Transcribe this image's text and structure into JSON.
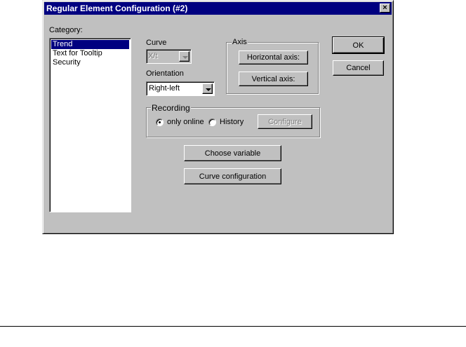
{
  "dialog": {
    "title": "Regular Element Configuration (#2)",
    "close": "×"
  },
  "category": {
    "label": "Category:",
    "items": [
      "Trend",
      "Text for Tooltip",
      "Security"
    ],
    "selected": "Trend"
  },
  "curve": {
    "label": "Curve",
    "value": "X/t"
  },
  "orientation": {
    "label": "Orientation",
    "value": "Right-left"
  },
  "axis": {
    "label": "Axis",
    "horizontal": "Horizontal axis:",
    "vertical": "Vertical axis:"
  },
  "buttons": {
    "ok": "OK",
    "cancel": "Cancel",
    "choose_variable": "Choose variable",
    "curve_configuration": "Curve configuration"
  },
  "recording": {
    "label": "Recording",
    "only_online": "only online",
    "history": "History",
    "configure": "Configure",
    "selected": "only online"
  },
  "colors": {
    "titlebar": "#000080",
    "face": "#c0c0c0",
    "selection": "#000080"
  }
}
